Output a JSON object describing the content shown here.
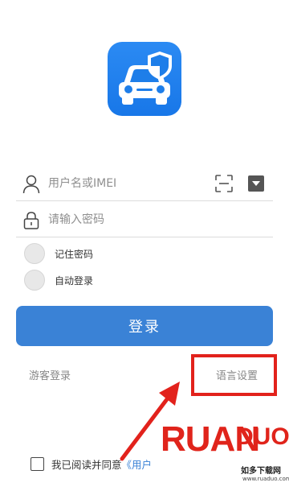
{
  "app": {
    "logo_icon": "car-with-shield-icon",
    "accent": "#3a82d6"
  },
  "username": {
    "placeholder": "用户名或IMEI",
    "scan_icon": "scan-icon",
    "dropdown_icon": "dropdown-icon"
  },
  "password": {
    "placeholder": "请输入密码"
  },
  "options": {
    "remember_password": "记住密码",
    "auto_login": "自动登录"
  },
  "login_button": "登录",
  "links": {
    "guest_login": "游客登录",
    "language_settings": "语言设置"
  },
  "agreement": {
    "text": "我已阅读并同意",
    "link": "《用户"
  },
  "annotation": {
    "highlight_color": "#e2221c"
  },
  "watermark": {
    "brand": "RUAN",
    "brand2": "DUO",
    "tagline": "如多下载网",
    "url": "www.ruaduo.com"
  }
}
